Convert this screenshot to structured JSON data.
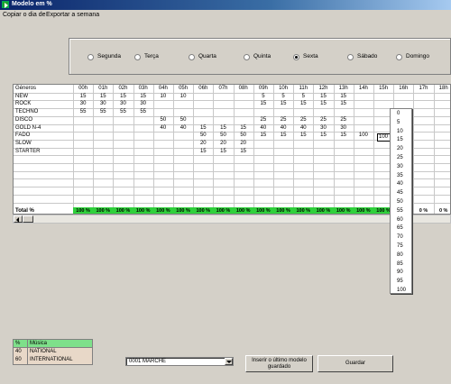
{
  "window": {
    "title": "Modelo em %"
  },
  "menu": [
    "Copiar o dia de",
    "Exportar a semana"
  ],
  "days": [
    {
      "label": "Segunda",
      "selected": false
    },
    {
      "label": "Terça",
      "selected": false
    },
    {
      "label": "Quarta",
      "selected": false
    },
    {
      "label": "Quinta",
      "selected": false
    },
    {
      "label": "Sexta",
      "selected": true
    },
    {
      "label": "Sábado",
      "selected": false
    },
    {
      "label": "Domingo",
      "selected": false
    }
  ],
  "grid": {
    "genre_header": "Géneros",
    "hours": [
      "00h",
      "01h",
      "02h",
      "03h",
      "04h",
      "05h",
      "06h",
      "07h",
      "08h",
      "09h",
      "10h",
      "11h",
      "12h",
      "13h",
      "14h",
      "15h",
      "16h",
      "17h",
      "18h"
    ],
    "rows": [
      {
        "genre": "NEW",
        "values": [
          "15",
          "15",
          "15",
          "15",
          "10",
          "10",
          "",
          "",
          "",
          "5",
          "5",
          "5",
          "15",
          "15",
          "",
          "",
          "",
          "",
          ""
        ]
      },
      {
        "genre": "ROCK",
        "values": [
          "30",
          "30",
          "30",
          "30",
          "",
          "",
          "",
          "",
          "",
          "15",
          "15",
          "15",
          "15",
          "15",
          "",
          "",
          "",
          "",
          ""
        ]
      },
      {
        "genre": "TECHNO",
        "values": [
          "55",
          "55",
          "55",
          "55",
          "",
          "",
          "",
          "",
          "",
          "",
          "",
          "",
          "",
          "",
          "",
          "",
          "",
          "",
          ""
        ]
      },
      {
        "genre": "DISCO",
        "values": [
          "",
          "",
          "",
          "",
          "50",
          "50",
          "",
          "",
          "",
          "25",
          "25",
          "25",
          "25",
          "25",
          "",
          "",
          "",
          "",
          ""
        ]
      },
      {
        "genre": "GOLD N-4",
        "values": [
          "",
          "",
          "",
          "",
          "40",
          "40",
          "15",
          "15",
          "15",
          "40",
          "40",
          "40",
          "30",
          "30",
          "",
          "",
          "",
          "",
          ""
        ]
      },
      {
        "genre": "FADO",
        "values": [
          "",
          "",
          "",
          "",
          "",
          "",
          "50",
          "50",
          "50",
          "15",
          "15",
          "15",
          "15",
          "15",
          "100",
          "",
          "",
          "",
          ""
        ]
      },
      {
        "genre": "SLOW",
        "values": [
          "",
          "",
          "",
          "",
          "",
          "",
          "20",
          "20",
          "20",
          "",
          "",
          "",
          "",
          "",
          "",
          "",
          "",
          "",
          ""
        ]
      },
      {
        "genre": "STARTER",
        "values": [
          "",
          "",
          "",
          "",
          "",
          "",
          "15",
          "15",
          "15",
          "",
          "",
          "",
          "",
          "",
          "",
          "",
          "",
          "",
          ""
        ]
      }
    ],
    "total_label": "Total %",
    "totals": [
      "100 %",
      "100 %",
      "100 %",
      "100 %",
      "100 %",
      "100 %",
      "100 %",
      "100 %",
      "100 %",
      "100 %",
      "100 %",
      "100 %",
      "100 %",
      "100 %",
      "100 %",
      "100 %",
      "",
      "0 %",
      "0 %"
    ],
    "total_ok_color": "#2fd03b"
  },
  "editor": {
    "current_value": "100",
    "options": [
      "0",
      "5",
      "10",
      "15",
      "20",
      "25",
      "30",
      "35",
      "40",
      "45",
      "50",
      "55",
      "60",
      "65",
      "70",
      "75",
      "80",
      "85",
      "90",
      "95",
      "100"
    ],
    "highlighted": "0"
  },
  "music": {
    "header_pct": "%",
    "header_name": "Música",
    "items": [
      {
        "pct": "40",
        "name": "NATIONAL"
      },
      {
        "pct": "60",
        "name": "INTERNATIONAL"
      }
    ]
  },
  "model_select": {
    "value": "0001 MARCHE"
  },
  "buttons": {
    "insert_last": "Inserir o último modelo guardado",
    "save": "Guardar"
  }
}
